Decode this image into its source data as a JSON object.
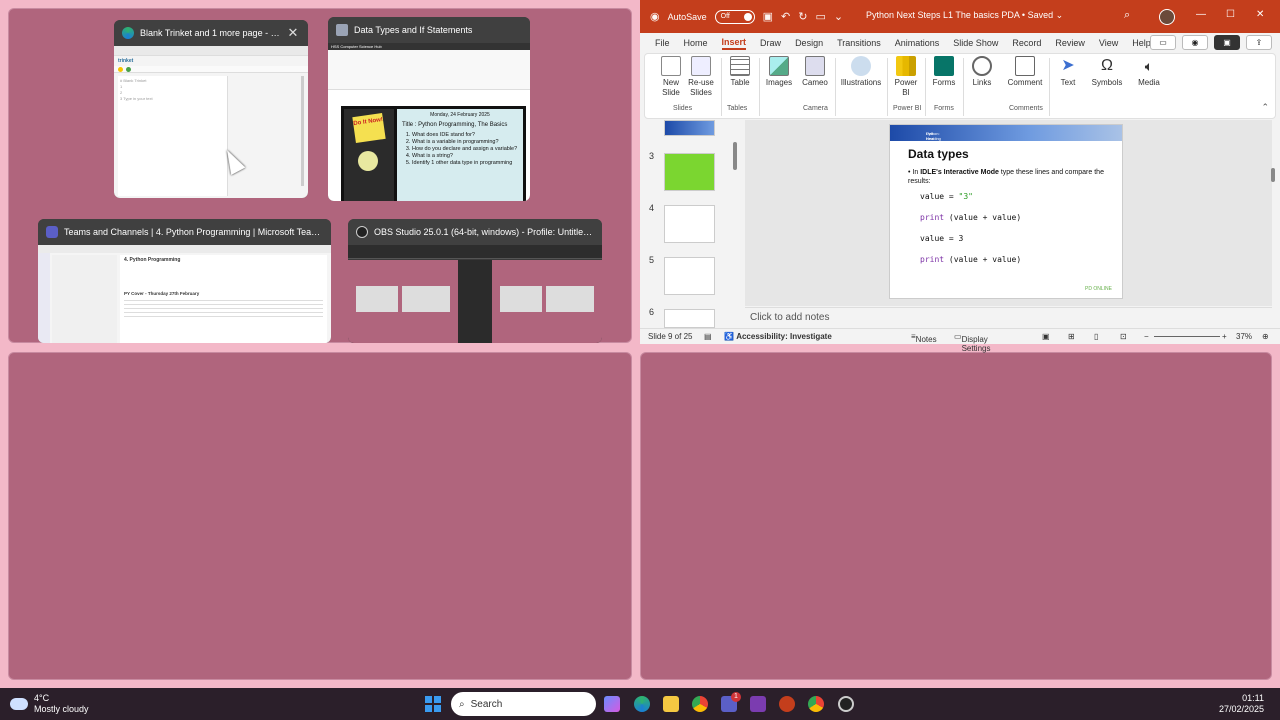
{
  "thumbnails": {
    "edge": {
      "title": "Blank Trinket and 1 more page - Perso...",
      "app_icon": "edge-icon",
      "content_brand": "trinket",
      "content_lines": [
        "# Blank Trinket",
        "1",
        "2",
        "3 Type in your text"
      ]
    },
    "powerpoint": {
      "title": "Data Types and If Statements",
      "app_icon": "powerpoint-icon",
      "header_text": "HSS Computer Science Hub",
      "date": "Monday, 24 February 2025",
      "note_title": "Do It Now!",
      "heading": "Title : Python Programming, The Basics",
      "questions": [
        "What does IDE stand for?",
        "What is a variable in programming?",
        "How do you declare and assign a variable?",
        "What is a string?",
        "Identify 1 other data type in programming"
      ]
    },
    "teams": {
      "title": "Teams and Channels | 4. Python Programming | Microsoft Teams",
      "app_icon": "teams-icon",
      "channel": "4. Python Programming",
      "post_title": "PY Cover - Thursday 27th February"
    },
    "obs": {
      "title": "OBS Studio 25.0.1 (64-bit, windows) - Profile: Untitled - Scen...",
      "app_icon": "obs-icon"
    }
  },
  "powerpoint": {
    "autosave_label": "AutoSave",
    "autosave_state": "Off",
    "doc_title": "Python Next Steps L1 The basics PDA",
    "saved_state": "Saved",
    "menu": [
      "File",
      "Home",
      "Insert",
      "Draw",
      "Design",
      "Transitions",
      "Animations",
      "Slide Show",
      "Record",
      "Review",
      "View",
      "Help"
    ],
    "active_menu": "Insert",
    "ribbon": {
      "new_slide": "New Slide",
      "reuse_slides": "Re-use Slides",
      "group_slides": "Slides",
      "table": "Table",
      "group_tables": "Tables",
      "images": "Images",
      "cameo": "Cameo",
      "group_camera": "Camera",
      "illustrations": "Illustrations",
      "power_bi": "Power BI",
      "group_power_bi": "Power BI",
      "forms": "Forms",
      "group_forms": "Forms",
      "links": "Links",
      "comment": "Comment",
      "group_comments": "Comments",
      "text": "Text",
      "symbols": "Symbols",
      "media": "Media"
    },
    "slide_numbers": [
      "3",
      "4",
      "5",
      "6"
    ],
    "slide": {
      "banner_line1": "Unit Heading",
      "banner_line2": "Python: Next steps",
      "title": "Data types",
      "bullet_prefix": "In ",
      "bullet_bold": "IDLE's Interactive Mode",
      "bullet_rest": " type these lines and compare the results:",
      "code1_a": "value = ",
      "code1_b": "\"3\"",
      "code2_kw": "print",
      "code2_rest": " (value + value)",
      "code3": "value = 3",
      "code4_kw": "print",
      "code4_rest": " (value + value)",
      "logo": "PD ONLINE"
    },
    "notes_placeholder": "Click to add notes",
    "status": {
      "slide_count": "Slide 9 of 25",
      "accessibility": "Accessibility: Investigate",
      "notes": "Notes",
      "display_settings": "Display Settings",
      "zoom": "37%"
    }
  },
  "taskbar": {
    "weather_temp": "4°C",
    "weather_desc": "Mostly cloudy",
    "search_label": "Search",
    "teams_badge": "1",
    "time": "01:11",
    "date": "27/02/2025"
  }
}
